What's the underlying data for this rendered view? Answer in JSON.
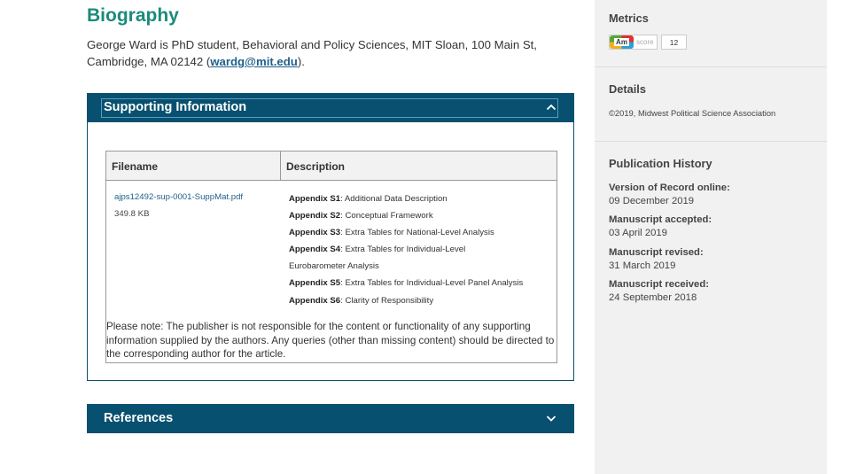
{
  "biography": {
    "title": "Biography",
    "text_before": "George Ward is PhD student, Behavioral and Policy Sciences, MIT Sloan, 100 Main St, Cambridge, MA 02142 (",
    "email": "wardg@mit.edu",
    "text_after": ")."
  },
  "supporting_info": {
    "title": "Supporting Information",
    "headers": {
      "filename": "Filename",
      "description": "Description"
    },
    "file": {
      "name": "ajps12492-sup-0001-SuppMat.pdf",
      "size": "349.8 KB"
    },
    "appendices": [
      {
        "label": "Appendix S1",
        "text": ": Additional Data Description"
      },
      {
        "label": "Appendix S2",
        "text": ": Conceptual Framework"
      },
      {
        "label": "Appendix S3",
        "text": ": Extra Tables for National-Level Analysis"
      },
      {
        "label": "Appendix S4",
        "text": ": Extra Tables for Individual-Level Eurobarometer Analysis"
      },
      {
        "label": "Appendix S5",
        "text": ": Extra Tables for Individual-Level Panel Analysis"
      },
      {
        "label": "Appendix S6",
        "text": ": Clarity of Responsibility"
      }
    ],
    "note": "Please note: The publisher is not responsible for the content or functionality of any supporting information supplied by the authors. Any queries (other than missing content) should be directed to the corresponding author for the article."
  },
  "references": {
    "title": "References"
  },
  "sidebar": {
    "metrics": {
      "title": "Metrics",
      "badge": "Am",
      "badge_label": "score",
      "count": "12"
    },
    "details": {
      "title": "Details",
      "copyright": "©2019, Midwest Political Science Association"
    },
    "history": {
      "title": "Publication History",
      "items": [
        {
          "label": "Version of Record online:",
          "value": "09 December 2019"
        },
        {
          "label": "Manuscript accepted:",
          "value": "03 April 2019"
        },
        {
          "label": "Manuscript revised:",
          "value": "31 March 2019"
        },
        {
          "label": "Manuscript received:",
          "value": "24 September 2018"
        }
      ]
    }
  },
  "icons": {
    "collapse": "chevron-up-icon",
    "expand": "chevron-down-icon"
  },
  "colors": {
    "accent": "#1b8a7a",
    "header_bg": "#08506f",
    "link": "#1f5f8b",
    "sidebar_bg": "#f1f1f1"
  }
}
